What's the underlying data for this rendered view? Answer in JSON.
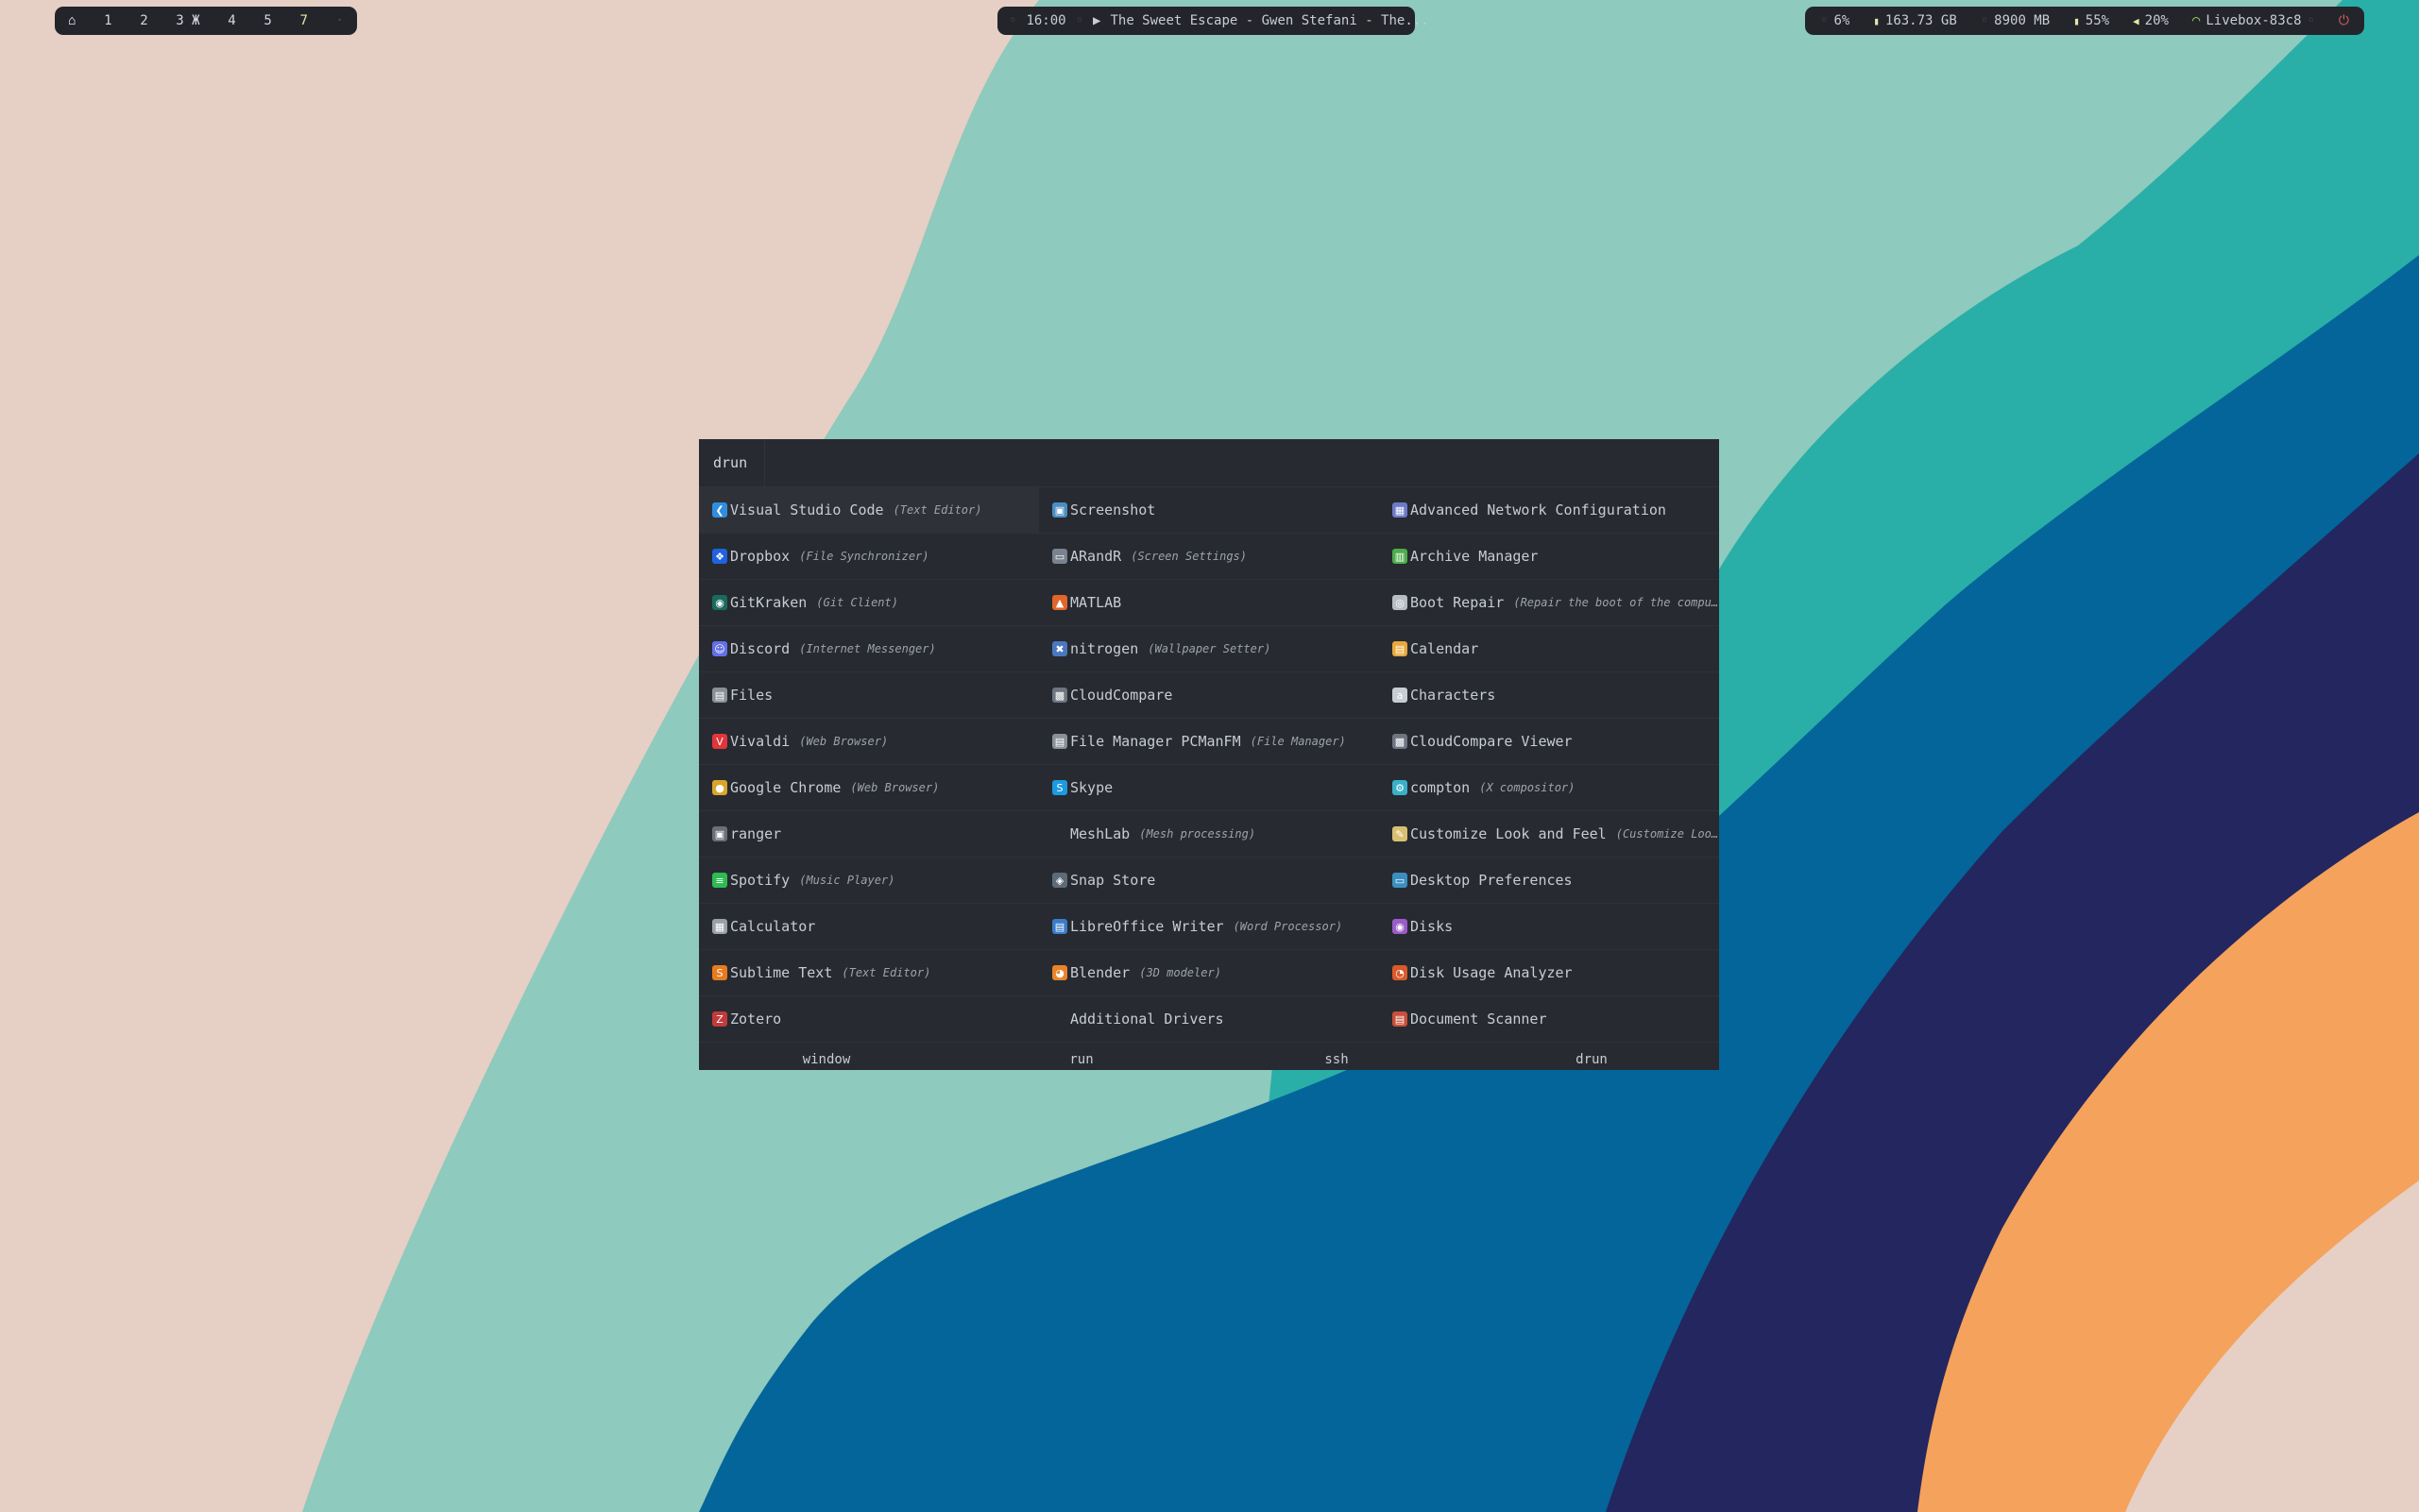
{
  "colors": {
    "wallpaper_pink": "#e6cfc4",
    "wallpaper_teal_light": "#8ecabd",
    "wallpaper_teal": "#2aaea8",
    "wallpaper_blue": "#03659a",
    "wallpaper_navy": "#24265f",
    "wallpaper_orange": "#f5a25c",
    "bar_bg": "#23252b",
    "launcher_bg": "#272a30"
  },
  "topbar": {
    "left": {
      "home_icon": "home-icon",
      "workspaces": [
        {
          "label": "1",
          "state": "normal"
        },
        {
          "label": "2",
          "state": "normal"
        },
        {
          "label": "3",
          "state": "normal",
          "marker": "Ж"
        },
        {
          "label": "4",
          "state": "normal"
        },
        {
          "label": "5",
          "state": "normal"
        },
        {
          "label": "7",
          "state": "active"
        },
        {
          "label": "·",
          "state": "dim"
        }
      ]
    },
    "center": {
      "time": "16:00",
      "play_icon": "▶",
      "media": "The Sweet Escape - Gwen Stefani - The..."
    },
    "right": {
      "cpu": "6%",
      "disk": "163.73 GB",
      "memory": "8900 MB",
      "battery": "55%",
      "volume": "20%",
      "network": "Livebox-83c8"
    }
  },
  "launcher": {
    "prompt": "drun",
    "columns": [
      [
        {
          "name": "Visual Studio Code",
          "desc": "(Text Editor)",
          "icon": "vscode-icon",
          "color": "#2f8ee0",
          "glyph": "❮"
        },
        {
          "name": "Dropbox",
          "desc": "(File Synchronizer)",
          "icon": "dropbox-icon",
          "color": "#1f63e0",
          "glyph": "❖"
        },
        {
          "name": "GitKraken",
          "desc": "(Git Client)",
          "icon": "gitkraken-icon",
          "color": "#1a6a5e",
          "glyph": "◉"
        },
        {
          "name": "Discord",
          "desc": "(Internet Messenger)",
          "icon": "discord-icon",
          "color": "#6470e8",
          "glyph": "☺"
        },
        {
          "name": "Files",
          "desc": "",
          "icon": "files-icon",
          "color": "#8a8f98",
          "glyph": "▤"
        },
        {
          "name": "Vivaldi",
          "desc": "(Web Browser)",
          "icon": "vivaldi-icon",
          "color": "#e0363c",
          "glyph": "V"
        },
        {
          "name": "Google Chrome",
          "desc": "(Web Browser)",
          "icon": "chrome-icon",
          "color": "#d9a52b",
          "glyph": "●"
        },
        {
          "name": "ranger",
          "desc": "",
          "icon": "ranger-icon",
          "color": "#6b6f76",
          "glyph": "▣"
        },
        {
          "name": "Spotify",
          "desc": "(Music Player)",
          "icon": "spotify-icon",
          "color": "#2dbb52",
          "glyph": "≡"
        },
        {
          "name": "Calculator",
          "desc": "",
          "icon": "calculator-icon",
          "color": "#9aa0a8",
          "glyph": "▦"
        },
        {
          "name": "Sublime Text",
          "desc": "(Text Editor)",
          "icon": "sublime-icon",
          "color": "#e87b1e",
          "glyph": "S"
        },
        {
          "name": "Zotero",
          "desc": "",
          "icon": "zotero-icon",
          "color": "#c23a3a",
          "glyph": "Z"
        }
      ],
      [
        {
          "name": "Screenshot",
          "desc": "",
          "icon": "screenshot-icon",
          "color": "#4a8fc4",
          "glyph": "▣"
        },
        {
          "name": "ARandR",
          "desc": "(Screen Settings)",
          "icon": "monitor-icon",
          "color": "#7a8290",
          "glyph": "▭"
        },
        {
          "name": "MATLAB",
          "desc": "",
          "icon": "matlab-icon",
          "color": "#e0662b",
          "glyph": "▲"
        },
        {
          "name": "nitrogen",
          "desc": "(Wallpaper Setter)",
          "icon": "nitrogen-icon",
          "color": "#4a78c0",
          "glyph": "✖"
        },
        {
          "name": "CloudCompare",
          "desc": "",
          "icon": "cloudcompare-icon",
          "color": "#6d7580",
          "glyph": "▩"
        },
        {
          "name": "File Manager PCManFM",
          "desc": "(File Manager)",
          "icon": "folder-icon",
          "color": "#8a8f98",
          "glyph": "▤"
        },
        {
          "name": "Skype",
          "desc": "",
          "icon": "skype-icon",
          "color": "#1c9ae0",
          "glyph": "S"
        },
        {
          "name": "MeshLab",
          "desc": "(Mesh processing)",
          "icon": "",
          "color": "transparent",
          "glyph": ""
        },
        {
          "name": "Snap Store",
          "desc": "",
          "icon": "snapstore-icon",
          "color": "#5d6a78",
          "glyph": "◈"
        },
        {
          "name": "LibreOffice Writer",
          "desc": "(Word Processor)",
          "icon": "writer-icon",
          "color": "#3a7cc8",
          "glyph": "▤"
        },
        {
          "name": "Blender",
          "desc": "(3D modeler)",
          "icon": "blender-icon",
          "color": "#e8842a",
          "glyph": "◕"
        },
        {
          "name": "Additional Drivers",
          "desc": "",
          "icon": "",
          "color": "transparent",
          "glyph": ""
        }
      ],
      [
        {
          "name": "Advanced Network Configuration",
          "desc": "",
          "icon": "network-config-icon",
          "color": "#6d7ac8",
          "glyph": "▦"
        },
        {
          "name": "Archive Manager",
          "desc": "",
          "icon": "archive-icon",
          "color": "#4cae4c",
          "glyph": "▥"
        },
        {
          "name": "Boot Repair",
          "desc": "(Repair the boot of the compu…",
          "icon": "boot-repair-icon",
          "color": "#b8bcc4",
          "glyph": "◎"
        },
        {
          "name": "Calendar",
          "desc": "",
          "icon": "calendar-icon",
          "color": "#e8a83a",
          "glyph": "▤"
        },
        {
          "name": "Characters",
          "desc": "",
          "icon": "characters-icon",
          "color": "#c8ccd4",
          "glyph": "a"
        },
        {
          "name": "CloudCompare Viewer",
          "desc": "",
          "icon": "cloudcompare-viewer-icon",
          "color": "#6d7580",
          "glyph": "▩"
        },
        {
          "name": "compton",
          "desc": "(X compositor)",
          "icon": "compton-icon",
          "color": "#3ab0c8",
          "glyph": "⚙"
        },
        {
          "name": "Customize Look and Feel",
          "desc": "(Customize Look…",
          "icon": "customize-icon",
          "color": "#d8c070",
          "glyph": "✎"
        },
        {
          "name": "Desktop Preferences",
          "desc": "",
          "icon": "desktop-prefs-icon",
          "color": "#3a8fc0",
          "glyph": "▭"
        },
        {
          "name": "Disks",
          "desc": "",
          "icon": "disks-icon",
          "color": "#9a5cc8",
          "glyph": "◉"
        },
        {
          "name": "Disk Usage Analyzer",
          "desc": "",
          "icon": "disk-usage-icon",
          "color": "#d85a2a",
          "glyph": "◔"
        },
        {
          "name": "Document Scanner",
          "desc": "",
          "icon": "scanner-icon",
          "color": "#c8503a",
          "glyph": "▤"
        }
      ]
    ],
    "modes": [
      "window",
      "run",
      "ssh",
      "drun"
    ]
  }
}
